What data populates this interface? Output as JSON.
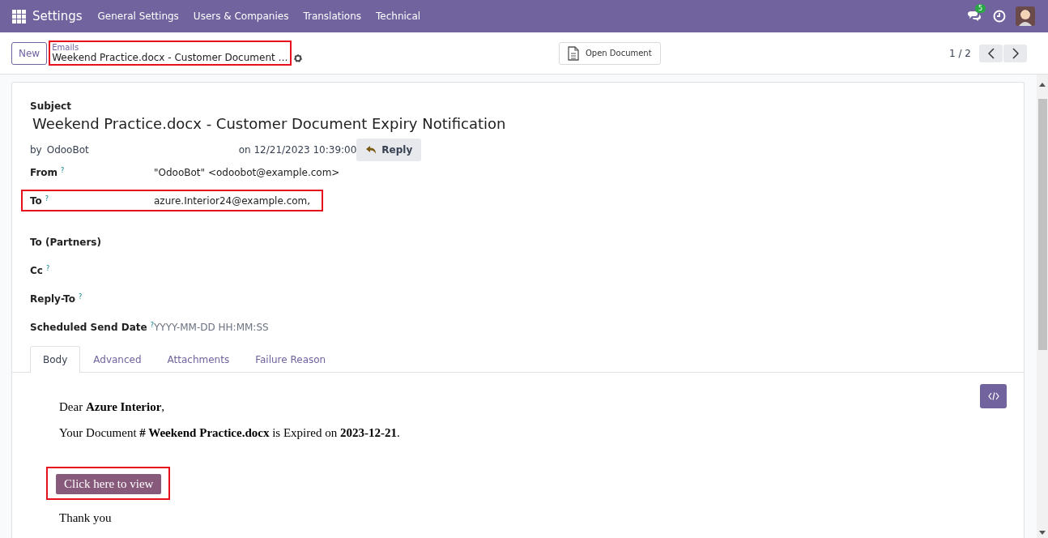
{
  "navbar": {
    "app": "Settings",
    "menu": [
      "General Settings",
      "Users & Companies",
      "Translations",
      "Technical"
    ],
    "messages_badge": "5"
  },
  "control_panel": {
    "new_button": "New",
    "breadcrumb": {
      "parent": "Emails",
      "current": "Weekend Practice.docx - Customer Document …",
      "highlighted": true
    },
    "action_button": "Open Document",
    "pager": "1 / 2"
  },
  "form": {
    "subject_label": "Subject",
    "subject": "Weekend Practice.docx - Customer Document Expiry Notification",
    "author_prefix": "by",
    "author": "OdooBot",
    "date": "on 12/21/2023 10:39:00",
    "reply_button": "Reply",
    "fields": [
      {
        "label": "From",
        "help": true,
        "value": "\"OdooBot\" <odoobot@example.com>",
        "highlighted": false
      },
      {
        "label": "To",
        "help": true,
        "value": "azure.Interior24@example.com,",
        "highlighted": true
      },
      {
        "label": "To (Partners)",
        "help": false,
        "highlighted": false
      },
      {
        "label": "Cc",
        "help": true,
        "highlighted": false
      },
      {
        "label": "Reply-To",
        "help": true,
        "highlighted": false
      },
      {
        "label": "Scheduled Send Date",
        "help": true,
        "placeholder": "YYYY-MM-DD HH:MM:SS",
        "highlighted": false
      }
    ],
    "help_mark": "?",
    "tabs": [
      {
        "label": "Body",
        "selected": true
      },
      {
        "label": "Advanced",
        "selected": false
      },
      {
        "label": "Attachments",
        "selected": false
      },
      {
        "label": "Failure Reason",
        "selected": false
      }
    ],
    "body": {
      "paragraphs": [
        "Dear **Azure Interior**,",
        "Your Document **# Weekend Practice.docx** is Expired on **2023-12-21**."
      ],
      "view_button": {
        "label": "Click here to view",
        "highlighted": true
      },
      "closing": "Thank you"
    }
  }
}
